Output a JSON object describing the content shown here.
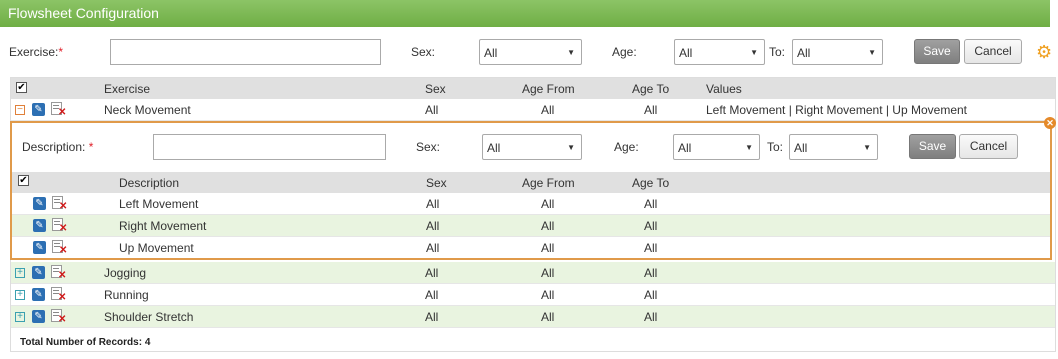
{
  "title": "Flowsheet Configuration",
  "filters": {
    "exercise_label": "Exercise:",
    "required_mark": "*",
    "exercise_value": "",
    "sex_label": "Sex:",
    "sex_value": "All",
    "age_label": "Age:",
    "age_value": "All",
    "to_label": "To:",
    "to_value": "All",
    "save_label": "Save",
    "cancel_label": "Cancel"
  },
  "grid": {
    "columns": [
      "Exercise",
      "Sex",
      "Age From",
      "Age To",
      "Values"
    ],
    "expanded_row": {
      "exercise": "Neck Movement",
      "sex": "All",
      "age_from": "All",
      "age_to": "All",
      "values": "Left Movement | Right Movement | Up Movement"
    },
    "rows": [
      {
        "exercise": "Jogging",
        "sex": "All",
        "age_from": "All",
        "age_to": "All"
      },
      {
        "exercise": "Running",
        "sex": "All",
        "age_from": "All",
        "age_to": "All"
      },
      {
        "exercise": "Shoulder Stretch",
        "sex": "All",
        "age_from": "All",
        "age_to": "All"
      }
    ],
    "footer": "Total Number of Records: 4"
  },
  "sub": {
    "description_label": "Description:",
    "required_mark": "*",
    "description_value": "",
    "sex_label": "Sex:",
    "sex_value": "All",
    "age_label": "Age:",
    "age_value": "All",
    "to_label": "To:",
    "to_value": "All",
    "save_label": "Save",
    "cancel_label": "Cancel",
    "columns": [
      "Description",
      "Sex",
      "Age From",
      "Age To"
    ],
    "rows": [
      {
        "description": "Left Movement",
        "sex": "All",
        "age_from": "All",
        "age_to": "All"
      },
      {
        "description": "Right Movement",
        "sex": "All",
        "age_from": "All",
        "age_to": "All"
      },
      {
        "description": "Up Movement",
        "sex": "All",
        "age_from": "All",
        "age_to": "All"
      }
    ]
  },
  "icons": {
    "settings": "gear-icon",
    "expand": "plus-expand-icon",
    "collapse": "minus-collapse-icon",
    "edit": "pencil-edit-icon",
    "delete": "delete-document-icon",
    "close": "close-icon"
  },
  "colors": {
    "title_green": "#6fae45",
    "alt_row": "#e9f4e0",
    "panel_border": "#e09a4a",
    "required": "#e0202a"
  }
}
